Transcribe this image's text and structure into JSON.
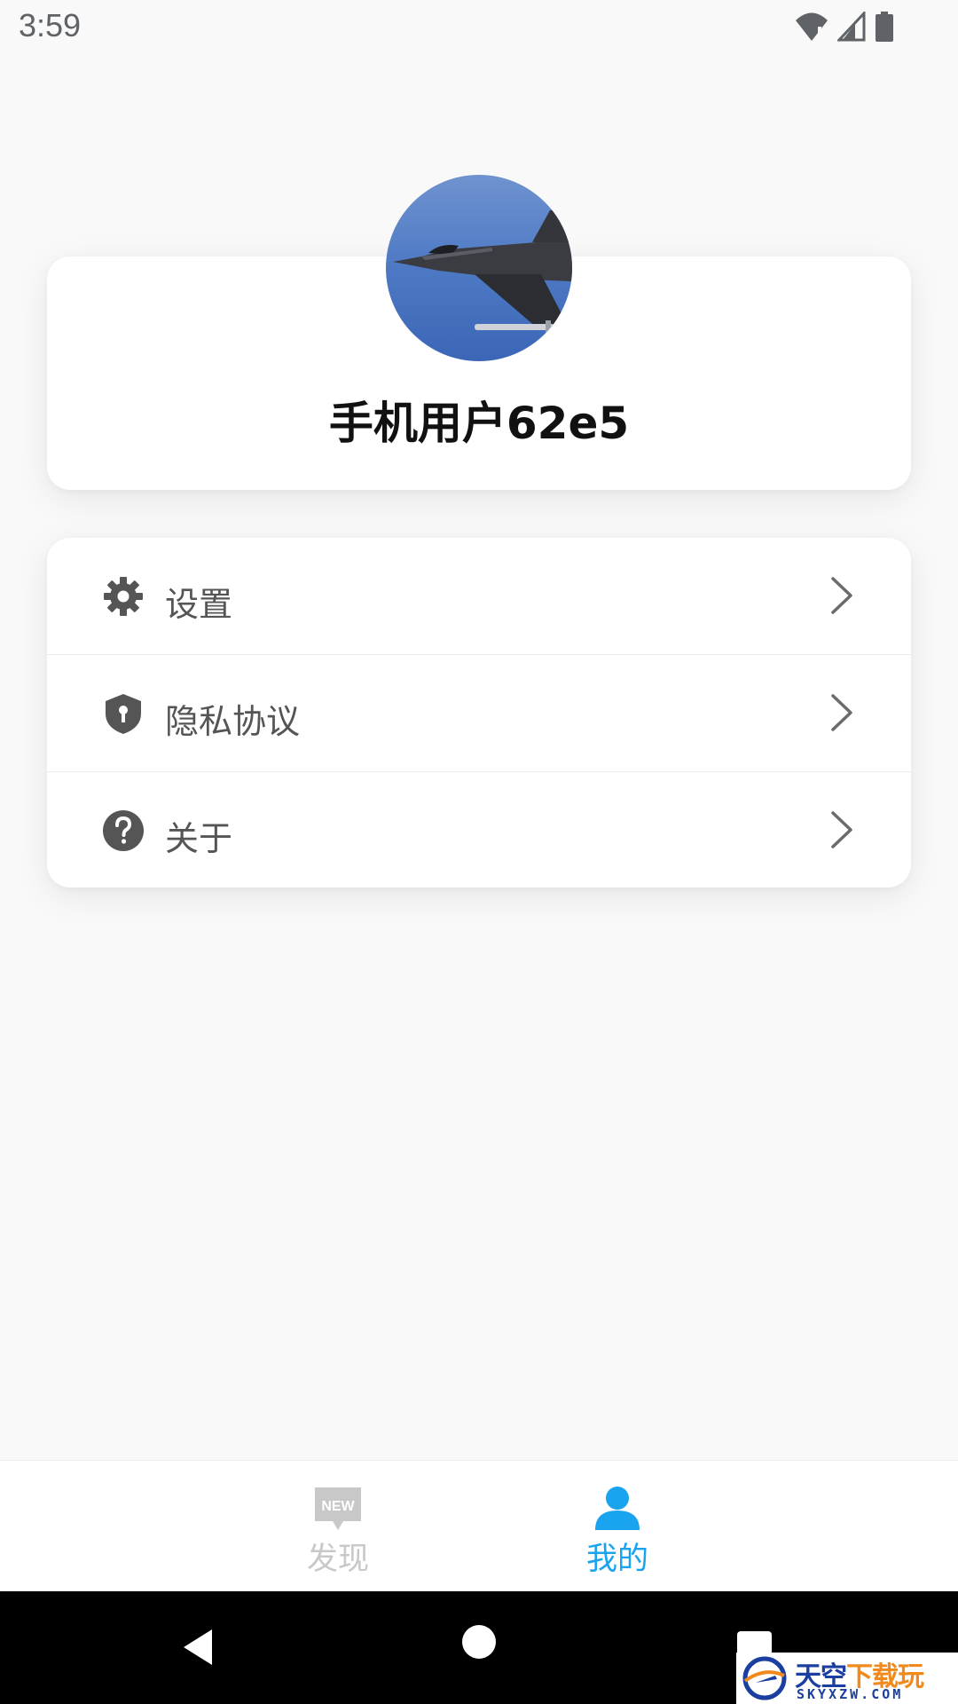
{
  "status_bar": {
    "time": "3:59",
    "icons": [
      "wifi-icon",
      "cell-signal-icon",
      "battery-icon"
    ]
  },
  "profile": {
    "username": "手机用户62e5",
    "avatar_icon": "fighter-jet-avatar"
  },
  "menu": {
    "items": [
      {
        "label": "设置",
        "icon": "gear-icon"
      },
      {
        "label": "隐私协议",
        "icon": "shield-icon"
      },
      {
        "label": "关于",
        "icon": "help-icon"
      }
    ]
  },
  "tab_bar": {
    "tabs": [
      {
        "label": "发现",
        "icon": "new-badge-icon",
        "active": false
      },
      {
        "label": "我的",
        "icon": "person-icon",
        "active": true
      }
    ],
    "new_badge_text": "NEW",
    "active_color": "#1aa3ee",
    "inactive_color": "#c8c8c8"
  },
  "watermark": {
    "title_main": "天空",
    "title_accent": "下载玩",
    "subtitle": "SKYXZW.COM"
  }
}
